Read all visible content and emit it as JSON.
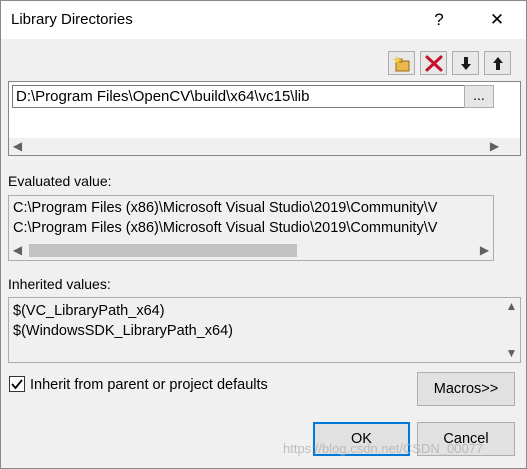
{
  "window": {
    "title": "Library Directories",
    "help_glyph": "?",
    "close_glyph": "✕"
  },
  "toolbar": {
    "buttons": [
      {
        "icon": "new-line-icon"
      },
      {
        "icon": "delete-icon"
      },
      {
        "icon": "move-down-icon"
      },
      {
        "icon": "move-up-icon"
      }
    ]
  },
  "directories": {
    "entries": [
      "D:\\Program Files\\OpenCV\\build\\x64\\vc15\\lib"
    ],
    "browse_label": "..."
  },
  "evaluated": {
    "label": "Evaluated value:",
    "lines": [
      "C:\\Program Files (x86)\\Microsoft Visual Studio\\2019\\Community\\V",
      "C:\\Program Files (x86)\\Microsoft Visual Studio\\2019\\Community\\V"
    ]
  },
  "inherited": {
    "label": "Inherited values:",
    "lines": [
      "$(VC_LibraryPath_x64)",
      "$(WindowsSDK_LibraryPath_x64)"
    ]
  },
  "inherit_checkbox": {
    "label": "Inherit from parent or project defaults",
    "checked": true
  },
  "buttons": {
    "macros": "Macros>>",
    "ok": "OK",
    "cancel": "Cancel"
  },
  "watermark": "https://blog.csdn.net/CSDN_00077"
}
